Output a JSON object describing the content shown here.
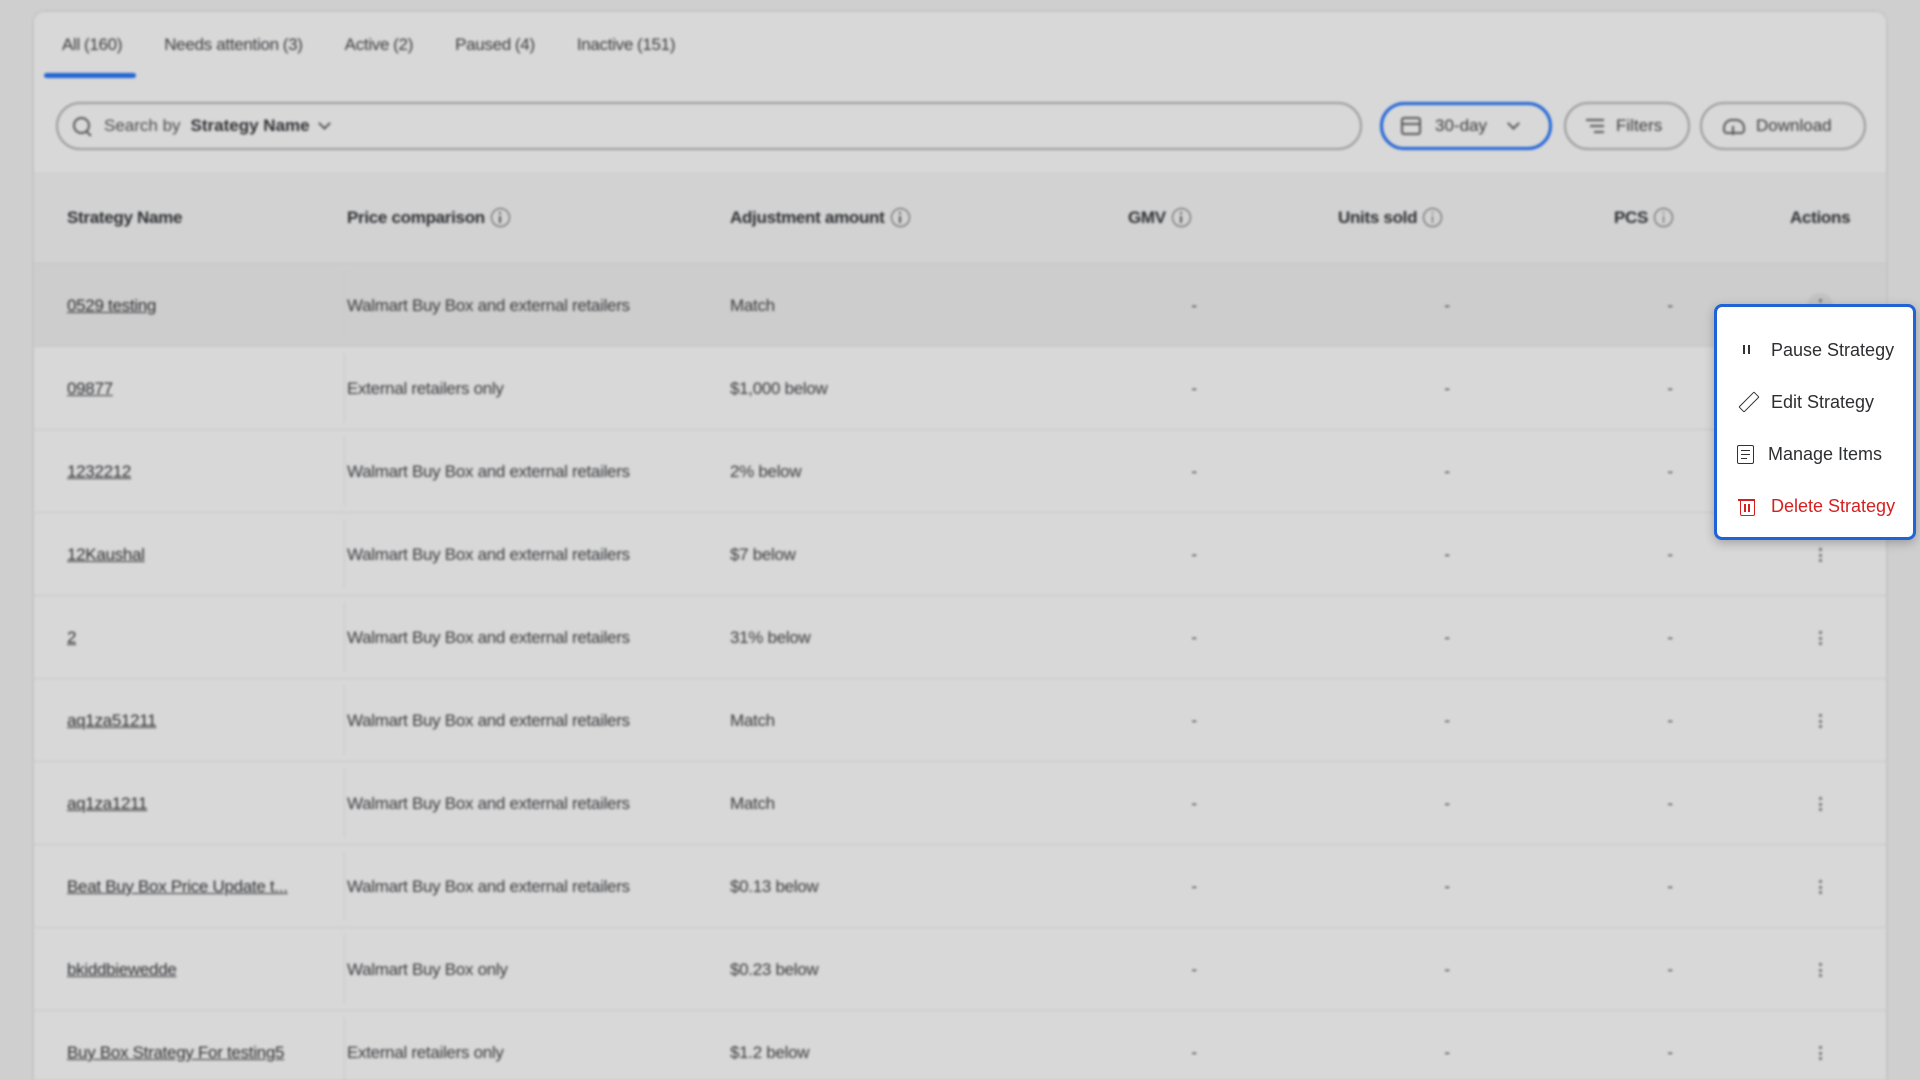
{
  "tabs": [
    {
      "label": "All",
      "count": "(160)",
      "active": true
    },
    {
      "label": "Needs attention",
      "count": "(3)",
      "active": false
    },
    {
      "label": "Active",
      "count": "(2)",
      "active": false
    },
    {
      "label": "Paused",
      "count": "(4)",
      "active": false
    },
    {
      "label": "Inactive",
      "count": "(151)",
      "active": false
    }
  ],
  "toolbar": {
    "search_label": "Search by",
    "search_field": "Strategy Name",
    "date_range": "30-day",
    "filters_label": "Filters",
    "download_label": "Download"
  },
  "table": {
    "columns": [
      "Strategy Name",
      "Price comparison",
      "Adjustment amount",
      "GMV",
      "Units sold",
      "PCS",
      "Actions"
    ],
    "rows": [
      {
        "name": "0529 testing",
        "comparison": "Walmart Buy Box and external retailers",
        "adjustment": "Match",
        "gmv": "-",
        "units": "-",
        "pcs": "-"
      },
      {
        "name": "09877",
        "comparison": "External retailers only",
        "adjustment": "$1,000 below",
        "gmv": "-",
        "units": "-",
        "pcs": "-"
      },
      {
        "name": "1232212",
        "comparison": "Walmart Buy Box and external retailers",
        "adjustment": "2% below",
        "gmv": "-",
        "units": "-",
        "pcs": "-"
      },
      {
        "name": "12Kaushal",
        "comparison": "Walmart Buy Box and external retailers",
        "adjustment": "$7 below",
        "gmv": "-",
        "units": "-",
        "pcs": "-"
      },
      {
        "name": "2",
        "comparison": "Walmart Buy Box and external retailers",
        "adjustment": "31% below",
        "gmv": "-",
        "units": "-",
        "pcs": "-"
      },
      {
        "name": "aq1za51211",
        "comparison": "Walmart Buy Box and external retailers",
        "adjustment": "Match",
        "gmv": "-",
        "units": "-",
        "pcs": "-"
      },
      {
        "name": "aq1za1211",
        "comparison": "Walmart Buy Box and external retailers",
        "adjustment": "Match",
        "gmv": "-",
        "units": "-",
        "pcs": "-"
      },
      {
        "name": "Beat Buy Box Price Update t...",
        "comparison": "Walmart Buy Box and external retailers",
        "adjustment": "$0.13 below",
        "gmv": "-",
        "units": "-",
        "pcs": "-"
      },
      {
        "name": "bkiddbiewedde",
        "comparison": "Walmart Buy Box only",
        "adjustment": "$0.23 below",
        "gmv": "-",
        "units": "-",
        "pcs": "-"
      },
      {
        "name": "Buy Box Strategy For testing5",
        "comparison": "External retailers only",
        "adjustment": "$1.2 below",
        "gmv": "-",
        "units": "-",
        "pcs": "-"
      }
    ]
  },
  "action_menu": {
    "items": [
      {
        "label": "Pause Strategy",
        "icon": "pause-icon"
      },
      {
        "label": "Edit Strategy",
        "icon": "pencil-icon"
      },
      {
        "label": "Manage Items",
        "icon": "items-list-icon"
      },
      {
        "label": "Delete Strategy",
        "icon": "trash-icon",
        "color": "#d61f1f"
      }
    ]
  },
  "colors": {
    "accent": "#1f63d6",
    "danger": "#d61f1f"
  }
}
